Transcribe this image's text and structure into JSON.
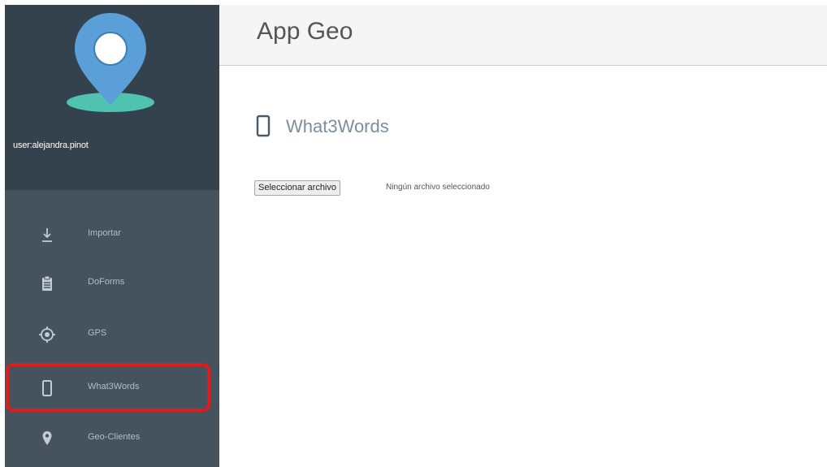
{
  "sidebar": {
    "username": "user:alejandra.pinot",
    "items": [
      {
        "label": "Importar",
        "icon": "download-icon"
      },
      {
        "label": "DoForms",
        "icon": "clipboard-icon"
      },
      {
        "label": "GPS",
        "icon": "gps-target-icon"
      },
      {
        "label": "What3Words",
        "icon": "phone-icon"
      },
      {
        "label": "Geo-Clientes",
        "icon": "map-pin-icon"
      }
    ],
    "highlighted_item": "What3Words",
    "logo_icon": "location-pin-icon"
  },
  "header": {
    "title": "App Geo"
  },
  "main": {
    "section_title": "What3Words",
    "section_icon": "phone-icon",
    "file_input": {
      "button_label": "Seleccionar archivo",
      "status": "Ningún archivo seleccionado"
    }
  },
  "colors": {
    "sidebar_bg": "#45535f",
    "profile_bg": "#34424d",
    "logo_blue": "#5b9fd8",
    "logo_teal": "#4fc3b0",
    "highlight_red": "#e01b1b",
    "section_title": "#7b8f9c"
  }
}
